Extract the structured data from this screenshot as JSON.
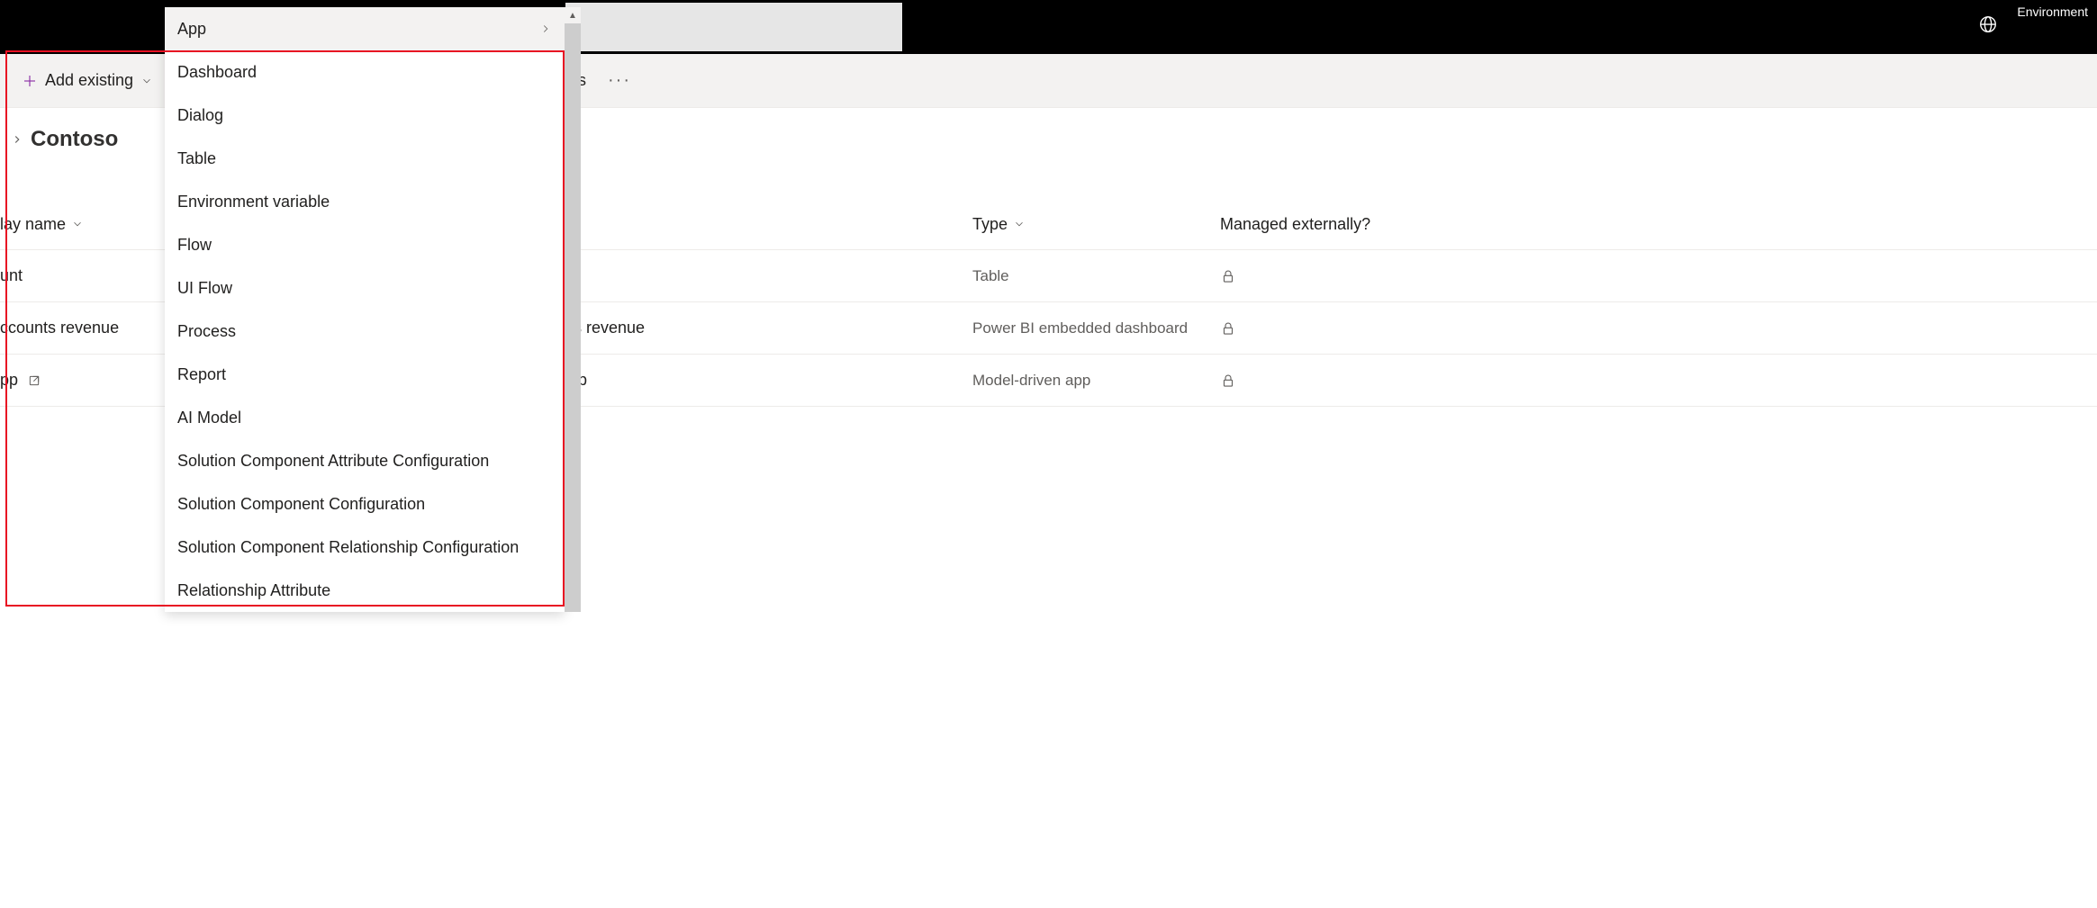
{
  "topbar": {
    "environment_label": "Environment"
  },
  "commandbar": {
    "add_existing": "Add existing",
    "publish_fragment": "ns"
  },
  "breadcrumb": {
    "current": "Contoso"
  },
  "table": {
    "headers": {
      "display_name": "lay name",
      "type": "Type",
      "managed": "Managed externally?"
    },
    "rows": [
      {
        "name_fragment": "unt",
        "full_name_fragment": "",
        "type": "Table"
      },
      {
        "name_fragment": "ccounts revenue",
        "full_name_fragment": "ts revenue",
        "type": "Power BI embedded dashboard"
      },
      {
        "name_fragment": "pp",
        "full_name_fragment": "pp",
        "type": "Model-driven app",
        "has_open": true
      }
    ]
  },
  "dropdown": {
    "items": [
      {
        "label": "App",
        "has_submenu": true
      },
      {
        "label": "Dashboard"
      },
      {
        "label": "Dialog"
      },
      {
        "label": "Table"
      },
      {
        "label": "Environment variable"
      },
      {
        "label": "Flow"
      },
      {
        "label": "UI Flow"
      },
      {
        "label": "Process"
      },
      {
        "label": "Report"
      },
      {
        "label": "AI Model"
      },
      {
        "label": "Solution Component Attribute Configuration"
      },
      {
        "label": "Solution Component Configuration"
      },
      {
        "label": "Solution Component Relationship Configuration"
      },
      {
        "label": "Relationship Attribute"
      }
    ]
  }
}
